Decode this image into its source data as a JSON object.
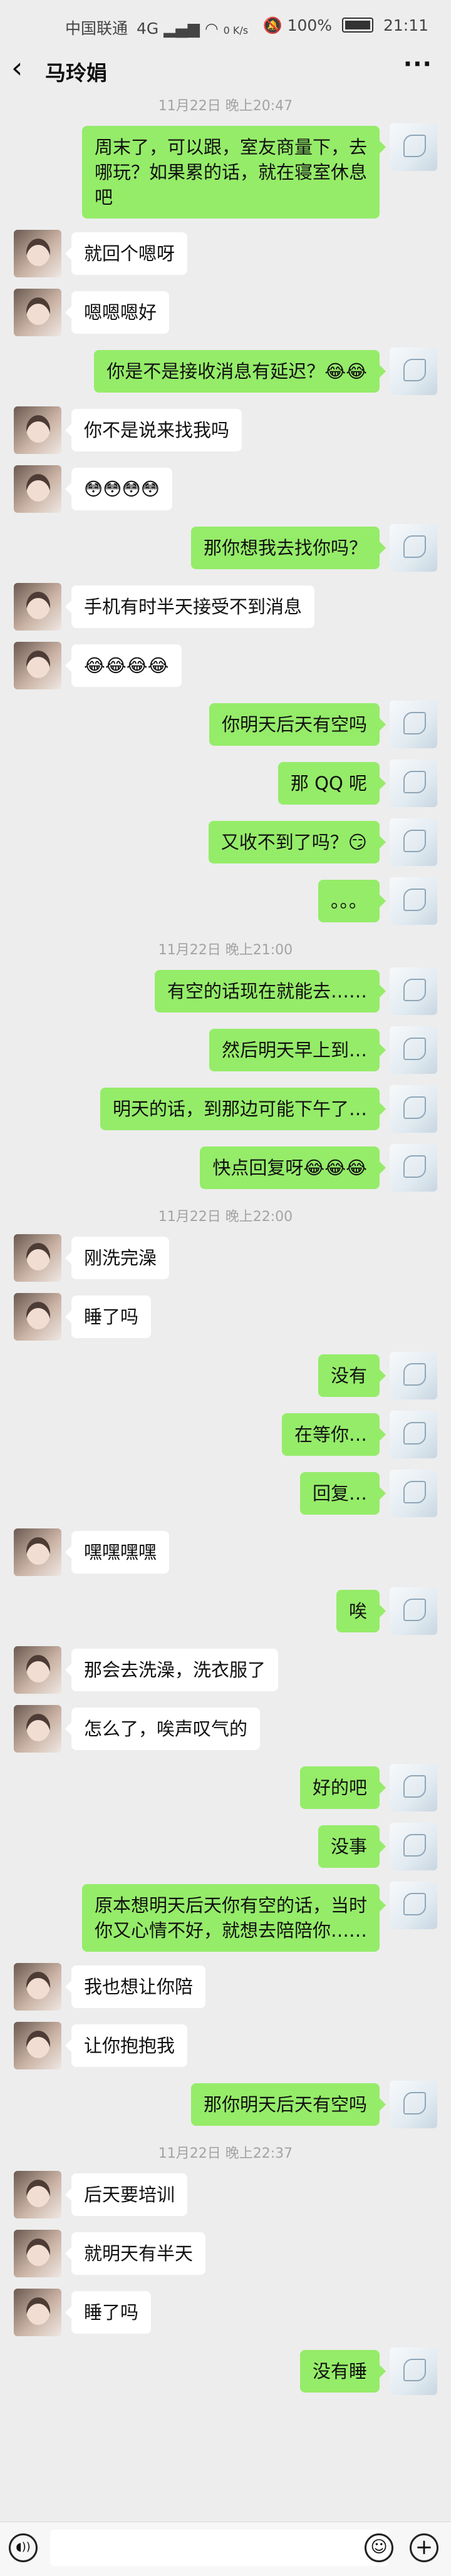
{
  "status": {
    "carrier": "中国联通",
    "net": "4G",
    "speed": "0 K/s",
    "battery": "100%",
    "time": "21:11"
  },
  "header": {
    "back": "‹",
    "title": "马玲娟",
    "more": "···"
  },
  "messages": [
    {
      "kind": "time",
      "text": "11月22日 晚上20:47"
    },
    {
      "kind": "msg",
      "side": "right",
      "lines": [
        "周末了，可以跟，室友商量下，去",
        "哪玩？如果累的话，就在寝室休息",
        "吧"
      ]
    },
    {
      "kind": "msg",
      "side": "left",
      "lines": [
        "就回个嗯呀"
      ]
    },
    {
      "kind": "msg",
      "side": "left",
      "lines": [
        "嗯嗯嗯好"
      ]
    },
    {
      "kind": "msg",
      "side": "right",
      "lines": [
        "你是不是接收消息有延迟？😂😂"
      ]
    },
    {
      "kind": "msg",
      "side": "left",
      "lines": [
        "你不是说来找我吗"
      ]
    },
    {
      "kind": "msg",
      "side": "left",
      "lines": [
        "😳😳😳😳"
      ]
    },
    {
      "kind": "msg",
      "side": "right",
      "lines": [
        "那你想我去找你吗？"
      ]
    },
    {
      "kind": "msg",
      "side": "left",
      "lines": [
        "手机有时半天接受不到消息"
      ]
    },
    {
      "kind": "msg",
      "side": "left",
      "lines": [
        "😂😂😂😂"
      ]
    },
    {
      "kind": "msg",
      "side": "right",
      "lines": [
        "你明天后天有空吗"
      ]
    },
    {
      "kind": "msg",
      "side": "right",
      "lines": [
        "那 QQ 呢"
      ]
    },
    {
      "kind": "msg",
      "side": "right",
      "lines": [
        "又收不到了吗？😏"
      ]
    },
    {
      "kind": "msg",
      "side": "right",
      "lines": [
        "。。。"
      ]
    },
    {
      "kind": "time",
      "text": "11月22日 晚上21:00"
    },
    {
      "kind": "msg",
      "side": "right",
      "lines": [
        "有空的话现在就能去……"
      ]
    },
    {
      "kind": "msg",
      "side": "right",
      "lines": [
        "然后明天早上到…"
      ]
    },
    {
      "kind": "msg",
      "side": "right",
      "lines": [
        "明天的话，到那边可能下午了…"
      ]
    },
    {
      "kind": "msg",
      "side": "right",
      "lines": [
        "快点回复呀😂😂😂"
      ]
    },
    {
      "kind": "time",
      "text": "11月22日 晚上22:00"
    },
    {
      "kind": "msg",
      "side": "left",
      "lines": [
        "刚洗完澡"
      ]
    },
    {
      "kind": "msg",
      "side": "left",
      "lines": [
        "睡了吗"
      ]
    },
    {
      "kind": "msg",
      "side": "right",
      "lines": [
        "没有"
      ]
    },
    {
      "kind": "msg",
      "side": "right",
      "lines": [
        "在等你…"
      ]
    },
    {
      "kind": "msg",
      "side": "right",
      "lines": [
        "回复…"
      ]
    },
    {
      "kind": "msg",
      "side": "left",
      "lines": [
        "嘿嘿嘿嘿"
      ]
    },
    {
      "kind": "msg",
      "side": "right",
      "lines": [
        "唉"
      ]
    },
    {
      "kind": "msg",
      "side": "left",
      "lines": [
        "那会去洗澡，洗衣服了"
      ]
    },
    {
      "kind": "msg",
      "side": "left",
      "lines": [
        "怎么了，唉声叹气的"
      ]
    },
    {
      "kind": "msg",
      "side": "right",
      "lines": [
        "好的吧"
      ]
    },
    {
      "kind": "msg",
      "side": "right",
      "lines": [
        "没事"
      ]
    },
    {
      "kind": "msg",
      "side": "right",
      "lines": [
        "原本想明天后天你有空的话，当时",
        "你又心情不好，就想去陪陪你……"
      ]
    },
    {
      "kind": "msg",
      "side": "left",
      "lines": [
        "我也想让你陪"
      ]
    },
    {
      "kind": "msg",
      "side": "left",
      "lines": [
        "让你抱抱我"
      ]
    },
    {
      "kind": "msg",
      "side": "right",
      "lines": [
        "那你明天后天有空吗"
      ]
    },
    {
      "kind": "time",
      "text": "11月22日 晚上22:37"
    },
    {
      "kind": "msg",
      "side": "left",
      "lines": [
        "后天要培训"
      ]
    },
    {
      "kind": "msg",
      "side": "left",
      "lines": [
        "就明天有半天"
      ]
    },
    {
      "kind": "msg",
      "side": "left",
      "lines": [
        "睡了吗"
      ]
    },
    {
      "kind": "msg",
      "side": "right",
      "lines": [
        "没有睡"
      ]
    }
  ],
  "icons": {
    "voice": "voice-icon",
    "emoji": "emoji-icon",
    "plus": "plus-icon"
  }
}
